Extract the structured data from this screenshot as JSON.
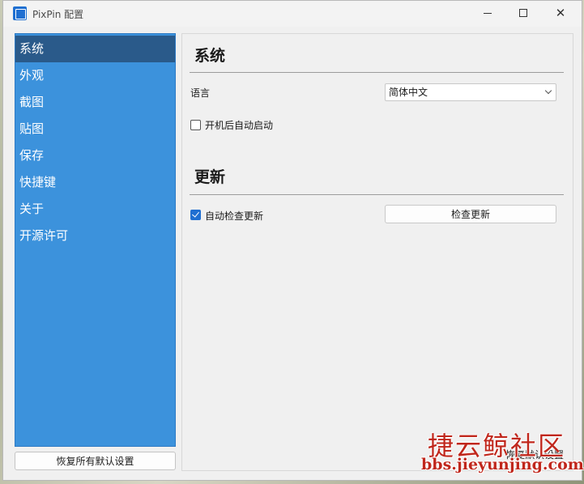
{
  "window": {
    "title": "PixPin 配置"
  },
  "sidebar": {
    "items": [
      {
        "label": "系统"
      },
      {
        "label": "外观"
      },
      {
        "label": "截图"
      },
      {
        "label": "贴图"
      },
      {
        "label": "保存"
      },
      {
        "label": "快捷键"
      },
      {
        "label": "关于"
      },
      {
        "label": "开源许可"
      }
    ],
    "active_index": 0,
    "reset_all_label": "恢复所有默认设置"
  },
  "system_section": {
    "title": "系统",
    "language_label": "语言",
    "language_value": "简体中文",
    "autostart_label": "开机后自动启动",
    "autostart_checked": false
  },
  "update_section": {
    "title": "更新",
    "auto_check_label": "自动检查更新",
    "auto_check_checked": true,
    "check_button_label": "检查更新"
  },
  "footer": {
    "reset_defaults_label": "恢复默认设置"
  },
  "watermark": {
    "text_cn": "捷云鲸社区",
    "text_url": "bbs.jieyunjing.com"
  },
  "colors": {
    "sidebar_bg": "#3c92dc",
    "sidebar_active": "#2a5a8a",
    "accent": "#1f6fd1",
    "watermark": "#c0271c"
  }
}
